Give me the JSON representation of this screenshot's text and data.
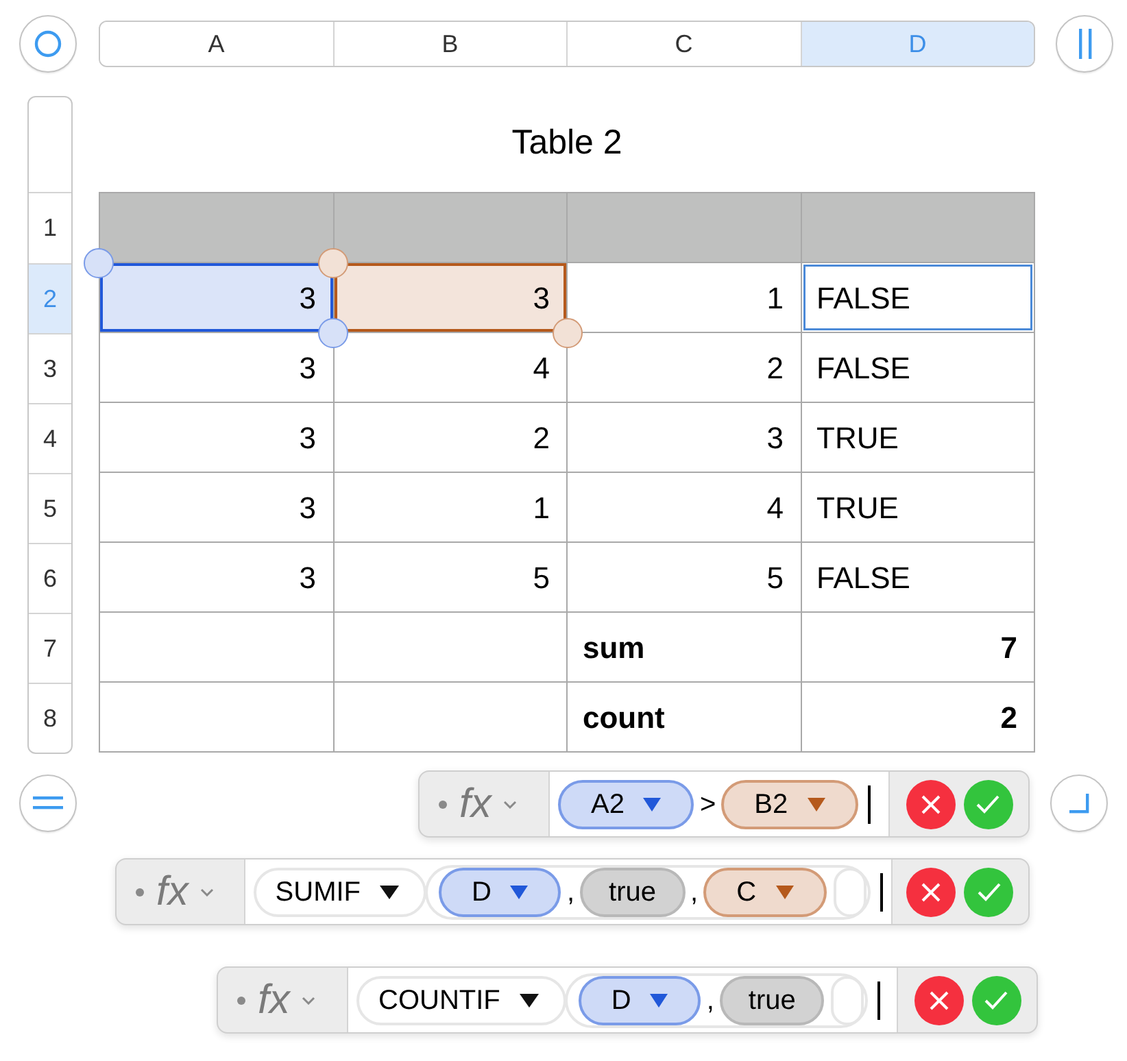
{
  "column_headers": [
    {
      "label": "A",
      "selected": false
    },
    {
      "label": "B",
      "selected": false
    },
    {
      "label": "C",
      "selected": false
    },
    {
      "label": "D",
      "selected": true
    }
  ],
  "row_headers": [
    {
      "label": "1",
      "selected": false
    },
    {
      "label": "2",
      "selected": true
    },
    {
      "label": "3",
      "selected": false
    },
    {
      "label": "4",
      "selected": false
    },
    {
      "label": "5",
      "selected": false
    },
    {
      "label": "6",
      "selected": false
    },
    {
      "label": "7",
      "selected": false
    },
    {
      "label": "8",
      "selected": false
    }
  ],
  "table": {
    "title": "Table 2",
    "rows": [
      {
        "kind": "header",
        "cells": [
          {
            "kind": "empty",
            "selected": false
          },
          {
            "kind": "empty",
            "selected": false
          },
          {
            "kind": "empty",
            "selected": false
          },
          {
            "kind": "empty",
            "selected": false
          }
        ]
      },
      {
        "kind": "body",
        "cells": [
          {
            "kind": "number",
            "text": "3",
            "selected": false,
            "color": "#2158d9"
          },
          {
            "kind": "number",
            "text": "3",
            "selected": false,
            "color": "#b5591c"
          },
          {
            "kind": "number",
            "text": "1",
            "selected": false
          },
          {
            "kind": "text",
            "text": "FALSE",
            "selected": true
          }
        ]
      },
      {
        "kind": "body",
        "cells": [
          {
            "kind": "number",
            "text": "3",
            "selected": false
          },
          {
            "kind": "number",
            "text": "4",
            "selected": false
          },
          {
            "kind": "number",
            "text": "2",
            "selected": false
          },
          {
            "kind": "text",
            "text": "FALSE",
            "selected": false
          }
        ]
      },
      {
        "kind": "body",
        "cells": [
          {
            "kind": "number",
            "text": "3",
            "selected": false
          },
          {
            "kind": "number",
            "text": "2",
            "selected": false
          },
          {
            "kind": "number",
            "text": "3",
            "selected": false
          },
          {
            "kind": "text",
            "text": "TRUE",
            "selected": false
          }
        ]
      },
      {
        "kind": "body",
        "cells": [
          {
            "kind": "number",
            "text": "3",
            "selected": false
          },
          {
            "kind": "number",
            "text": "1",
            "selected": false
          },
          {
            "kind": "number",
            "text": "4",
            "selected": false
          },
          {
            "kind": "text",
            "text": "TRUE",
            "selected": false
          }
        ]
      },
      {
        "kind": "body",
        "cells": [
          {
            "kind": "number",
            "text": "3",
            "selected": false
          },
          {
            "kind": "number",
            "text": "5",
            "selected": false
          },
          {
            "kind": "number",
            "text": "5",
            "selected": false
          },
          {
            "kind": "text",
            "text": "FALSE",
            "selected": false
          }
        ]
      },
      {
        "kind": "footer",
        "cells": [
          {
            "kind": "empty",
            "selected": false
          },
          {
            "kind": "empty",
            "selected": false
          },
          {
            "kind": "text",
            "text": "sum",
            "selected": false
          },
          {
            "kind": "number",
            "text": "7",
            "selected": false
          }
        ]
      },
      {
        "kind": "footer",
        "cells": [
          {
            "kind": "empty",
            "selected": false
          },
          {
            "kind": "empty",
            "selected": false
          },
          {
            "kind": "text",
            "text": "count",
            "selected": false
          },
          {
            "kind": "number",
            "text": "2",
            "selected": false
          }
        ]
      }
    ]
  },
  "formula_bars": [
    {
      "fx_label": "fx",
      "tokens": [
        {
          "kind": "reference",
          "text": "A2",
          "color": "#2158d9"
        },
        {
          "kind": "operator",
          "text": ">"
        },
        {
          "kind": "reference",
          "text": "B2",
          "color": "#b5591c"
        }
      ]
    },
    {
      "fx_label": "fx",
      "function": "SUMIF",
      "tokens": [
        {
          "kind": "reference",
          "text": "D",
          "color": "#2158d9"
        },
        {
          "kind": "separator",
          "text": ","
        },
        {
          "kind": "value",
          "text": "true"
        },
        {
          "kind": "separator",
          "text": ","
        },
        {
          "kind": "reference",
          "text": "C",
          "color": "#b5591c"
        }
      ]
    },
    {
      "fx_label": "fx",
      "function": "COUNTIF",
      "tokens": [
        {
          "kind": "reference",
          "text": "D",
          "color": "#2158d9"
        },
        {
          "kind": "separator",
          "text": ","
        },
        {
          "kind": "value",
          "text": "true"
        }
      ]
    }
  ]
}
